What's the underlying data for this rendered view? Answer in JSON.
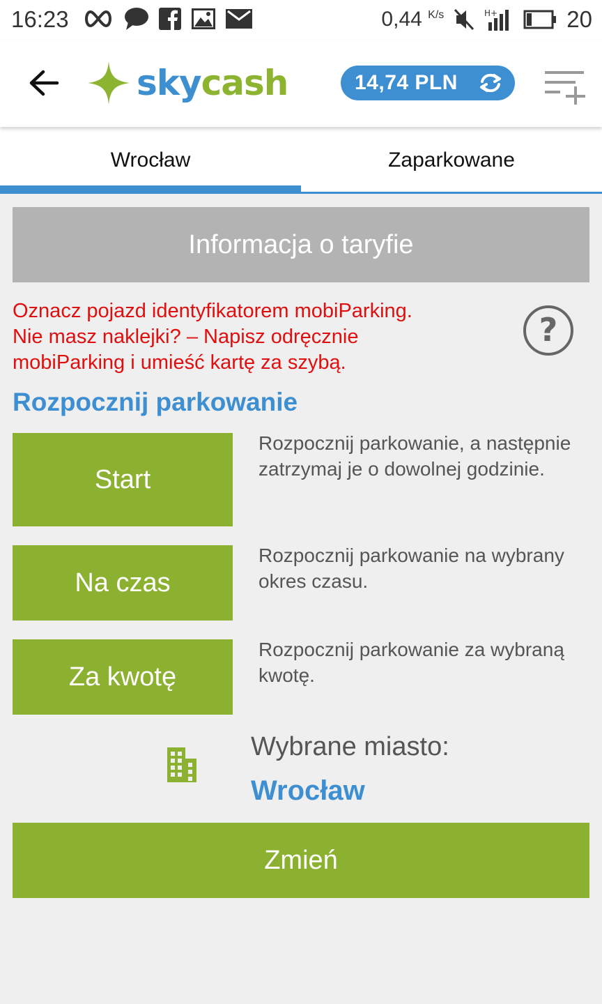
{
  "status_bar": {
    "time": "16:23",
    "speed": "0,44",
    "speed_unit": "K/s",
    "battery": "20",
    "icons": [
      "infinity-icon",
      "chat-icon",
      "facebook-icon",
      "image-icon",
      "mail-icon",
      "mute-icon",
      "signal-icon",
      "battery-icon"
    ]
  },
  "header": {
    "logo_sky": "sky",
    "logo_cash": "cash",
    "balance": "14,74 PLN"
  },
  "tabs": [
    {
      "label": "Wrocław",
      "active": true
    },
    {
      "label": "Zaparkowane",
      "active": false
    }
  ],
  "main": {
    "tariff_button": "Informacja o taryfie",
    "warning_lines": [
      "Oznacz pojazd identyfikatorem mobiParking.",
      "Nie masz naklejki? – Napisz odręcznie",
      "mobiParking i umieść kartę za szybą."
    ],
    "section_title": "Rozpocznij parkowanie",
    "options": [
      {
        "label": "Start",
        "description": "Rozpocznij parkowanie, a następnie zatrzymaj je o dowolnej godzinie."
      },
      {
        "label": "Na czas",
        "description": "Rozpocznij parkowanie na wybrany okres czasu."
      },
      {
        "label": "Za kwotę",
        "description": "Rozpocznij parkowanie za wybraną kwotę."
      }
    ],
    "city_label": "Wybrane miasto:",
    "city_name": "Wrocław",
    "change_button": "Zmień"
  },
  "colors": {
    "brand_blue": "#3d8fd1",
    "brand_green": "#8cb030",
    "warning_red": "#e00f0f",
    "tariff_gray": "#b3b3b3"
  }
}
